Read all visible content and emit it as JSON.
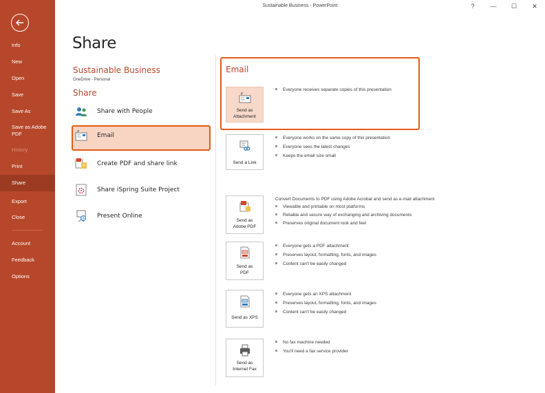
{
  "window": {
    "title": "Sustainable Business  -  PowerPoint",
    "help_label": "?",
    "minimize_label": "—",
    "restore_label": "☐",
    "close_label": "✕"
  },
  "sidebar": {
    "background": "#b7472a",
    "items": [
      {
        "label": "Info"
      },
      {
        "label": "New"
      },
      {
        "label": "Open"
      },
      {
        "label": "Save"
      },
      {
        "label": "Save As"
      },
      {
        "label": "Save as Adobe\nPDF"
      },
      {
        "label": "History",
        "disabled": true
      },
      {
        "label": "Print"
      },
      {
        "label": "Share",
        "selected": true
      },
      {
        "label": "Export"
      },
      {
        "label": "Close"
      },
      {
        "label": "Account"
      },
      {
        "label": "Feedback"
      },
      {
        "label": "Options"
      }
    ]
  },
  "page": {
    "title": "Share",
    "doc_title": "Sustainable Business",
    "doc_location": "OneDrive - Personal",
    "share_heading": "Share"
  },
  "share_options": [
    {
      "label": "Share with People",
      "icon": "people-icon"
    },
    {
      "label": "Email",
      "icon": "email-icon",
      "selected": true
    },
    {
      "label": "Create PDF and share link",
      "icon": "pdf-share-icon"
    },
    {
      "label": "Share iSpring Suite Project",
      "icon": "ispring-icon"
    },
    {
      "label": "Present Online",
      "icon": "present-online-icon"
    }
  ],
  "email": {
    "heading": "Email",
    "accent": "#e55b16",
    "actions": [
      {
        "label": "Send as\nAttachment",
        "icon": "attachment-icon",
        "selected": true,
        "bullets": [
          "Everyone receives separate copies of this presentation"
        ]
      },
      {
        "label": "Send a Link",
        "icon": "link-icon",
        "bullets": [
          "Everyone works on the same copy of this presentation",
          "Everyone sees the latest changes",
          "Keeps the email size small"
        ]
      },
      {
        "label": "Send as\nAdobe PDF",
        "icon": "adobe-pdf-icon",
        "heading": "Convert Documents to PDF using Adobe Acrobat and send as e-mail attachment",
        "bullets": [
          "Viewable and printable on most platforms",
          "Reliable and secure way of exchanging and archiving documents",
          "Preserves original document look and feel"
        ]
      },
      {
        "label": "Send as\nPDF",
        "icon": "pdf-icon",
        "bullets": [
          "Everyone gets a PDF attachment",
          "Preserves layout, formatting, fonts, and images",
          "Content can't be easily changed"
        ]
      },
      {
        "label": "Send as XPS",
        "icon": "xps-icon",
        "bullets": [
          "Everyone gets an XPS attachment",
          "Preserves layout, formatting, fonts, and images",
          "Content can't be easily changed"
        ]
      },
      {
        "label": "Send as\nInternet Fax",
        "icon": "fax-icon",
        "bullets": [
          "No fax machine needed",
          "You'll need a fax service provider"
        ]
      }
    ]
  }
}
